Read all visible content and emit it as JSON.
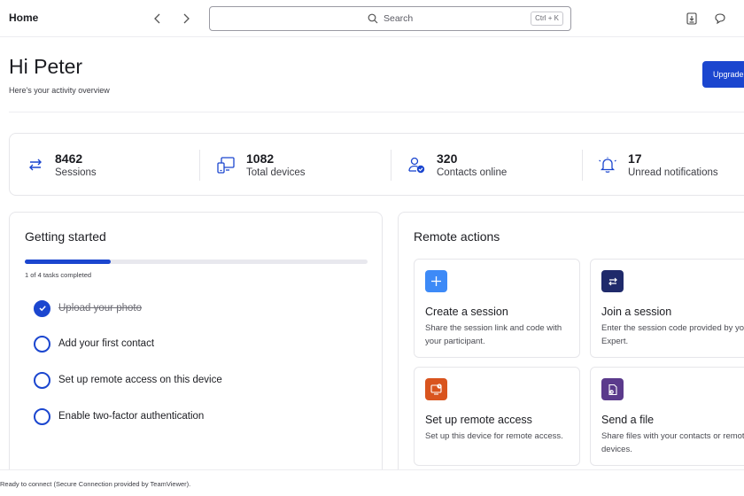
{
  "header": {
    "title": "Home",
    "search_placeholder": "Search",
    "search_shortcut": "Ctrl + K"
  },
  "greeting": {
    "title": "Hi Peter",
    "subtitle": "Here's your activity overview",
    "upgrade_label": "Upgrade"
  },
  "stats": [
    {
      "value": "8462",
      "label": "Sessions",
      "icon": "arrows-swap-icon"
    },
    {
      "value": "1082",
      "label": "Total devices",
      "icon": "devices-icon"
    },
    {
      "value": "320",
      "label": "Contacts online",
      "icon": "contact-online-icon"
    },
    {
      "value": "17",
      "label": "Unread notifications",
      "icon": "bell-icon"
    }
  ],
  "getting_started": {
    "title": "Getting started",
    "progress": 0.25,
    "progress_text": "1 of 4 tasks completed",
    "tasks": [
      {
        "label": "Upload your photo",
        "done": true
      },
      {
        "label": "Add your first contact",
        "done": false
      },
      {
        "label": "Set up remote access on this device",
        "done": false
      },
      {
        "label": "Enable two-factor authentication",
        "done": false
      }
    ]
  },
  "remote_actions": {
    "title": "Remote actions",
    "items": [
      {
        "title": "Create a session",
        "desc": "Share the session link and code with your participant.",
        "icon": "plus-icon",
        "color": "#3d8af7"
      },
      {
        "title": "Join a session",
        "desc": "Enter the session code provided by your Expert.",
        "icon": "arrows-swap-icon",
        "color": "#1f2a6b"
      },
      {
        "title": "Set up remote access",
        "desc": "Set up this device for remote access.",
        "icon": "remote-device-icon",
        "color": "#d9541e"
      },
      {
        "title": "Send a file",
        "desc": "Share files with your contacts or remote devices.",
        "icon": "file-send-icon",
        "color": "#5b3a8c"
      }
    ]
  },
  "status": {
    "text": "Ready to connect (Secure Connection provided by TeamViewer)."
  },
  "colors": {
    "accent": "#1b46cf"
  }
}
